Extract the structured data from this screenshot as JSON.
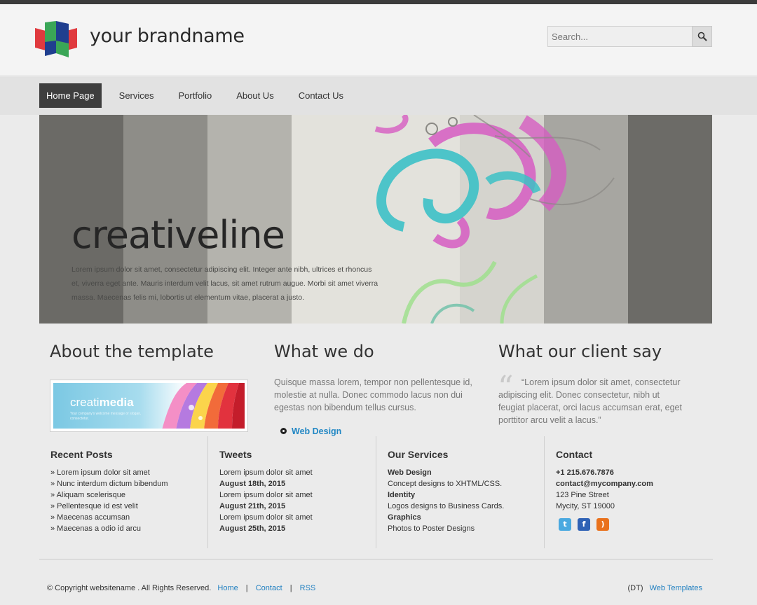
{
  "header": {
    "brand": "your brandname",
    "search_placeholder": "Search..."
  },
  "nav": [
    {
      "label": "Home Page",
      "active": true
    },
    {
      "label": "Services"
    },
    {
      "label": "Portfolio"
    },
    {
      "label": "About Us"
    },
    {
      "label": "Contact Us"
    }
  ],
  "hero": {
    "title": "creativeline",
    "text": "Lorem ipsum dolor sit amet, consectetur adipiscing elit. Integer ante nibh, ultrices et rhoncus et, viverra eget ante. Mauris interdum velit lacus, sit amet rutrum augue. Morbi sit amet viverra massa. Maecenas felis mi, lobortis ut elementum vitae, placerat a justo."
  },
  "about": {
    "title": "About the template",
    "banner_text_light": "creati",
    "banner_text_bold": "media",
    "banner_tagline": "Your company's welcome message or slogan, consectetur."
  },
  "whatwedo": {
    "title": "What we do",
    "text": "Quisque massa lorem, tempor non pellentesque id, molestie at nulla. Donec commodo lacus non dui egestas non bibendum tellus cursus.",
    "link": "Web Design"
  },
  "client": {
    "title": "What our client say",
    "quote_mark": "“",
    "quote": "“Lorem ipsum dolor sit amet, consectetur adipiscing elit. Donec consectetur, nibh ut feugiat placerat, orci lacus accumsan erat, eget porttitor arcu velit a lacus.”"
  },
  "recent_posts": {
    "title": "Recent Posts",
    "items": [
      "» Lorem ipsum dolor sit amet",
      "» Nunc interdum dictum bibendum",
      "» Aliquam scelerisque",
      "» Pellentesque id est velit",
      "» Maecenas accumsan",
      "» Maecenas a odio id arcu"
    ]
  },
  "tweets": {
    "title": "Tweets",
    "items": [
      {
        "text": "Lorem ipsum dolor sit amet",
        "date": "August 18th, 2015"
      },
      {
        "text": "Lorem ipsum dolor sit amet",
        "date": "August 21th, 2015"
      },
      {
        "text": "Lorem ipsum dolor sit amet",
        "date": "August 25th, 2015"
      }
    ]
  },
  "services": {
    "title": "Our Services",
    "items": [
      {
        "name": "Web Design",
        "desc": "Concept designs to XHTML/CSS."
      },
      {
        "name": "Identity",
        "desc": "Logos designs to Business Cards."
      },
      {
        "name": "Graphics",
        "desc": "Photos to Poster Designs"
      }
    ]
  },
  "contact": {
    "title": "Contact",
    "phone": "+1 215.676.7876",
    "email": "contact@mycompany.com",
    "street": "123 Pine Street",
    "city": "Mycity, ST 19000",
    "social": [
      {
        "icon": "twitter-icon",
        "color": "#4aa9e0"
      },
      {
        "icon": "facebook-icon",
        "color": "#2f62b5"
      },
      {
        "icon": "rss-icon",
        "color": "#e9711c"
      }
    ]
  },
  "footer": {
    "copyright": "© Copyright websitename . All Rights Reserved.",
    "links": [
      "Home",
      "Contact",
      "RSS"
    ],
    "separator": "|",
    "credit_prefix": "(DT)",
    "credit_link": "Web Templates"
  },
  "colors": {
    "accent_link": "#2187c4",
    "nav_active": "#3e3e3e",
    "logo_red": "#e03a3e",
    "logo_green": "#3aa657",
    "logo_blue": "#1f3f8f"
  }
}
